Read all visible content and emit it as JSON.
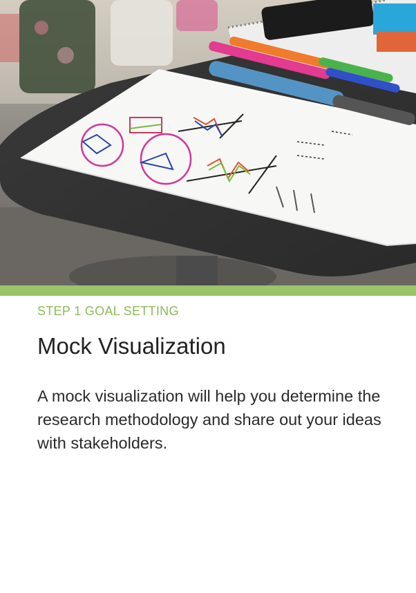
{
  "colors": {
    "accent_green": "#9cc46a",
    "step_label": "#8dbb57",
    "title": "#222222",
    "body": "#2a2a2a"
  },
  "photo": {
    "description_icon": "photo-image"
  },
  "card": {
    "step_label": "STEP 1 GOAL SETTING",
    "title": "Mock Visualization",
    "body": "A mock visualization will help you determine the research methodology and share out your ideas with stakeholders."
  }
}
